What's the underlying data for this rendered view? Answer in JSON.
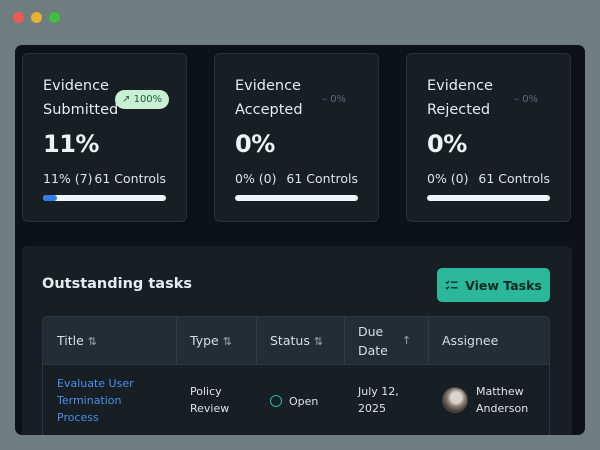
{
  "window_dots": [
    {
      "name": "close",
      "color": "#ee5a52"
    },
    {
      "name": "minimize",
      "color": "#e6b233"
    },
    {
      "name": "zoom",
      "color": "#3fbf3f"
    }
  ],
  "cards": [
    {
      "title_line1": "Evidence",
      "title_line2": "Submitted",
      "badge_icon": "↗",
      "badge_text": "100%",
      "badge_style": "good",
      "value": "11%",
      "count": "11% (7)",
      "controls": "61 Controls",
      "progress": 0.11
    },
    {
      "title_line1": "Evidence",
      "title_line2": "Accepted",
      "badge_icon": "–",
      "badge_text": "0%",
      "badge_style": "muted",
      "value": "0%",
      "count": "0% (0)",
      "controls": "61 Controls",
      "progress": 0
    },
    {
      "title_line1": "Evidence",
      "title_line2": "Rejected",
      "badge_icon": "–",
      "badge_text": "0%",
      "badge_style": "muted",
      "value": "0%",
      "count": "0% (0)",
      "controls": "61 Controls",
      "progress": 0
    }
  ],
  "tasks": {
    "title": "Outstanding tasks",
    "view_button": "View Tasks",
    "view_button_icon": "list-check-icon",
    "columns": {
      "title": "Title",
      "type": "Type",
      "status": "Status",
      "due_line1": "Due",
      "due_line2": "Date",
      "assignee": "Assignee",
      "sort_icon": "⇅",
      "sort_active_icon": "↑"
    },
    "rows": [
      {
        "title_line1": "Evaluate User",
        "title_line2": "Termination",
        "title_line3": "Process",
        "type_line1": "Policy",
        "type_line2": "Review",
        "status": "Open",
        "due_line1": "July 12,",
        "due_line2": "2025",
        "assignee_line1": "Matthew",
        "assignee_line2": "Anderson"
      }
    ]
  },
  "colors": {
    "accent": "#2bb89a",
    "progress": "#2f7ee5",
    "link": "#4a90e8",
    "badge_good_bg": "#c9f0d4"
  }
}
